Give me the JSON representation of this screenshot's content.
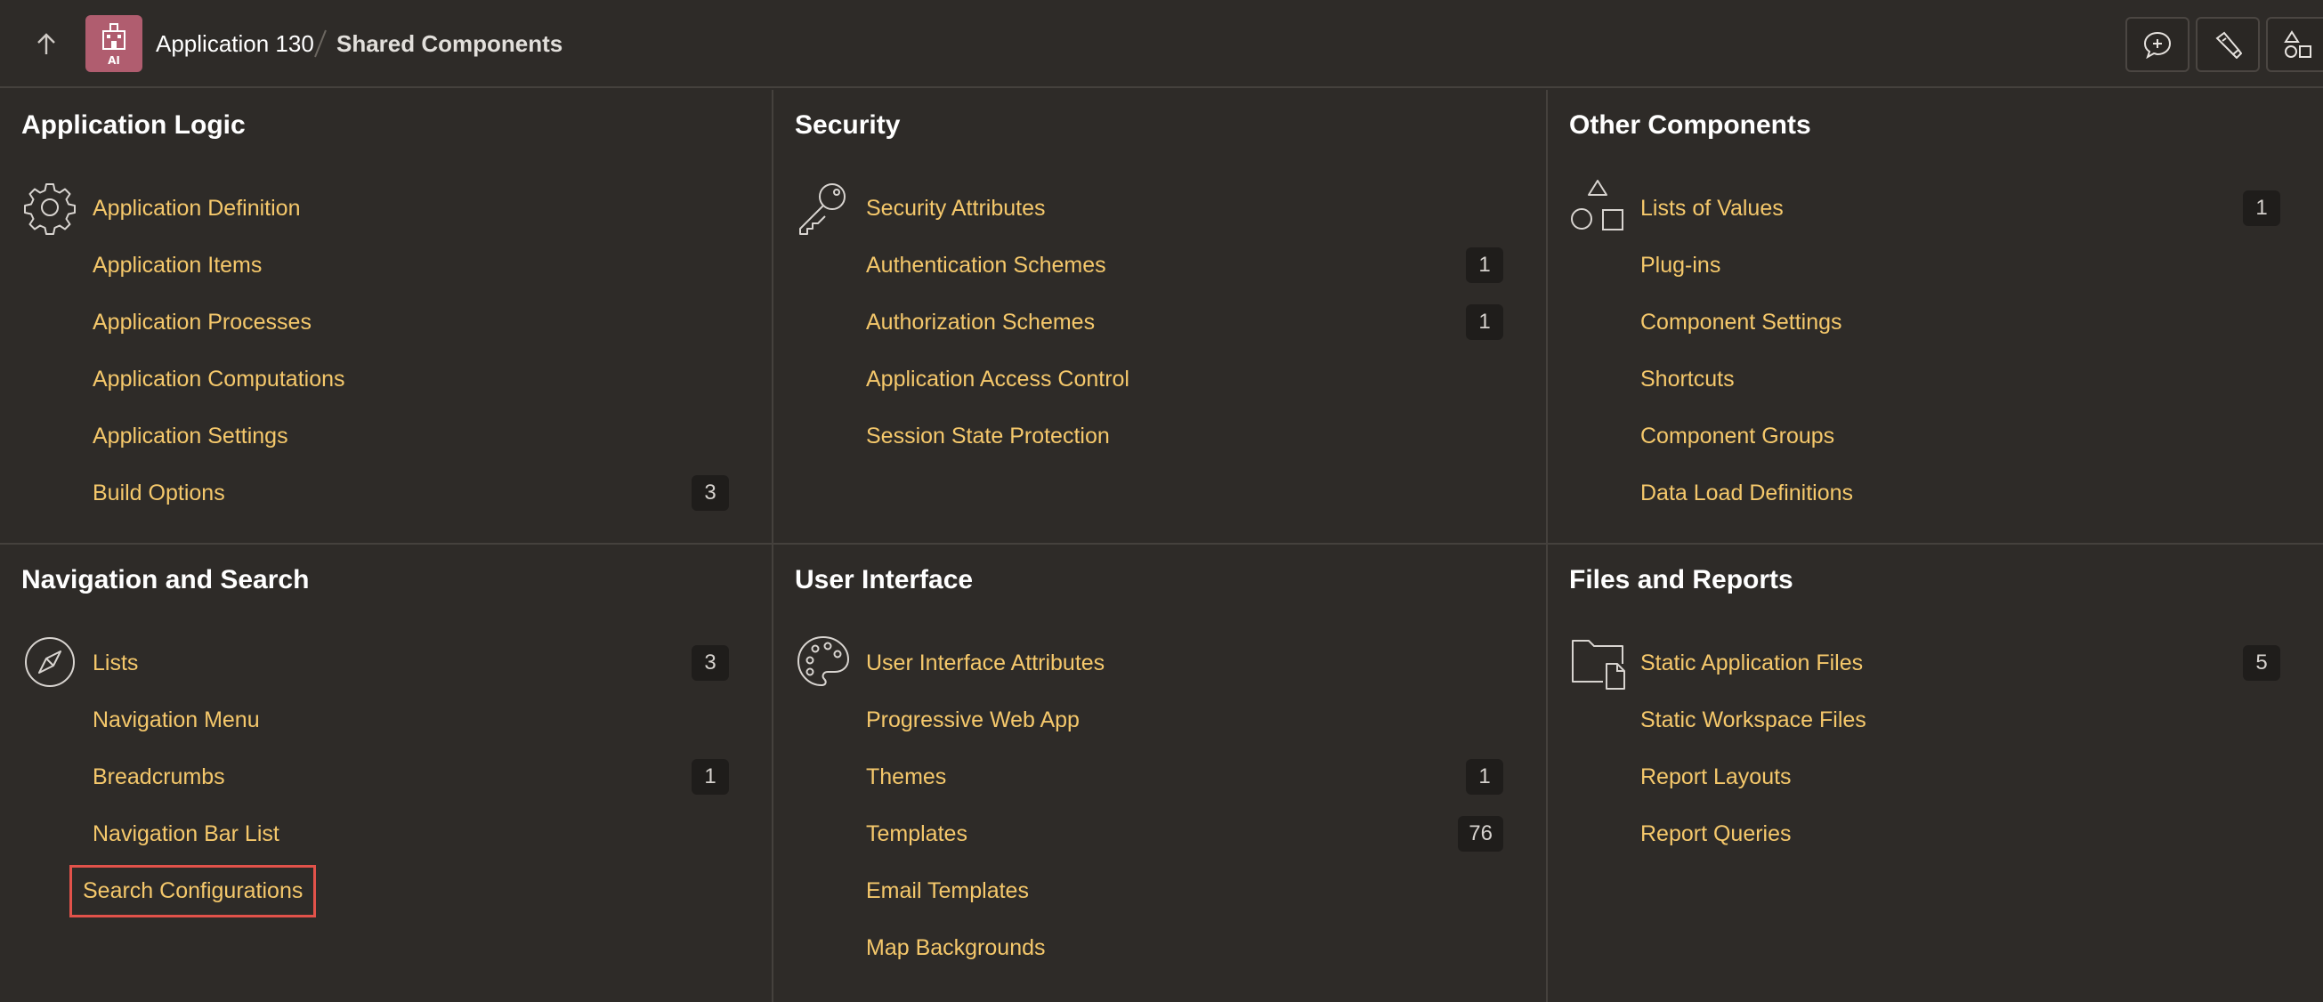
{
  "header": {
    "app_name": "Application 130",
    "current_page": "Shared Components",
    "badge_text": "AI",
    "badge_color": "#b05d6f"
  },
  "icons": {
    "up": "arrow-up-icon",
    "feedback": "chat-plus-icon",
    "utilities": "flashlight-icon",
    "shared": "shapes-icon"
  },
  "panels": [
    {
      "title": "Application Logic",
      "icon": "gear-icon",
      "items": [
        {
          "label": "Application Definition",
          "count": ""
        },
        {
          "label": "Application Items",
          "count": ""
        },
        {
          "label": "Application Processes",
          "count": ""
        },
        {
          "label": "Application Computations",
          "count": ""
        },
        {
          "label": "Application Settings",
          "count": ""
        },
        {
          "label": "Build Options",
          "count": "3"
        }
      ]
    },
    {
      "title": "Security",
      "icon": "key-icon",
      "items": [
        {
          "label": "Security Attributes",
          "count": ""
        },
        {
          "label": "Authentication Schemes",
          "count": "1"
        },
        {
          "label": "Authorization Schemes",
          "count": "1"
        },
        {
          "label": "Application Access Control",
          "count": ""
        },
        {
          "label": "Session State Protection",
          "count": ""
        }
      ]
    },
    {
      "title": "Other Components",
      "icon": "shapes-icon",
      "items": [
        {
          "label": "Lists of Values",
          "count": "1"
        },
        {
          "label": "Plug-ins",
          "count": ""
        },
        {
          "label": "Component Settings",
          "count": ""
        },
        {
          "label": "Shortcuts",
          "count": ""
        },
        {
          "label": "Component Groups",
          "count": ""
        },
        {
          "label": "Data Load Definitions",
          "count": ""
        }
      ]
    },
    {
      "title": "Navigation and Search",
      "icon": "compass-icon",
      "items": [
        {
          "label": "Lists",
          "count": "3"
        },
        {
          "label": "Navigation Menu",
          "count": ""
        },
        {
          "label": "Breadcrumbs",
          "count": "1"
        },
        {
          "label": "Navigation Bar List",
          "count": ""
        },
        {
          "label": "Search Configurations",
          "count": "",
          "highlighted": true
        }
      ]
    },
    {
      "title": "User Interface",
      "icon": "palette-icon",
      "items": [
        {
          "label": "User Interface Attributes",
          "count": ""
        },
        {
          "label": "Progressive Web App",
          "count": ""
        },
        {
          "label": "Themes",
          "count": "1"
        },
        {
          "label": "Templates",
          "count": "76"
        },
        {
          "label": "Email Templates",
          "count": ""
        },
        {
          "label": "Map Backgrounds",
          "count": ""
        }
      ]
    },
    {
      "title": "Files and Reports",
      "icon": "folder-file-icon",
      "items": [
        {
          "label": "Static Application Files",
          "count": "5"
        },
        {
          "label": "Static Workspace Files",
          "count": ""
        },
        {
          "label": "Report Layouts",
          "count": ""
        },
        {
          "label": "Report Queries",
          "count": ""
        }
      ]
    }
  ],
  "colors": {
    "background": "#2e2b28",
    "link": "#f5c86b",
    "highlight_border": "#e2524a",
    "count_badge": "#1f1d1b"
  }
}
